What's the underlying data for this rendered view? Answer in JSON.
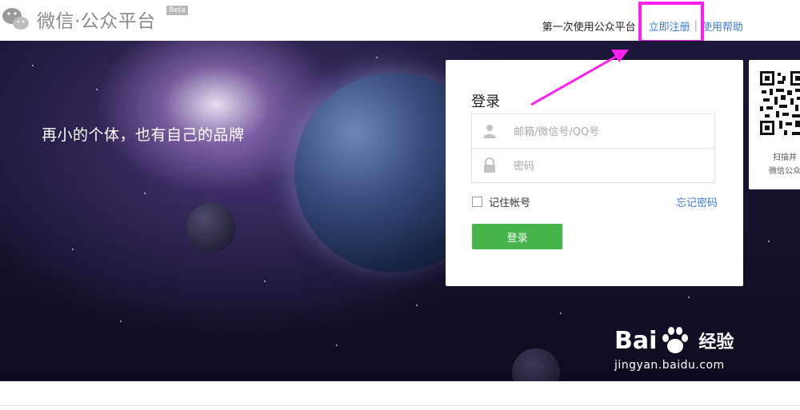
{
  "header": {
    "logo_icon": "wechat-logo-icon",
    "app_name": "微信·公众平台",
    "beta_badge": "Beta",
    "first_use_text": "第一次使用公众平台",
    "register_link": "立即注册",
    "separator": "|",
    "help_link": "使用帮助"
  },
  "banner": {
    "slogan": "再小的个体，也有自己的品牌"
  },
  "login": {
    "title": "登录",
    "account_placeholder": "邮箱/微信号/QQ号",
    "password_placeholder": "密码",
    "remember_label": "记住帐号",
    "forgot_link": "忘记密码",
    "submit_label": "登录",
    "icons": {
      "account": "user-icon",
      "password": "lock-icon"
    }
  },
  "qr_panel": {
    "icon": "qr-code-icon",
    "line1": "扫描并",
    "line2": "微信公众"
  },
  "watermark": {
    "brand": "Bai",
    "brand_suffix": "经验",
    "url": "jingyan.baidu.com"
  },
  "colors": {
    "accent_green": "#44b549",
    "link_blue": "#3a7ddc",
    "highlight_magenta": "#ff1ff0"
  }
}
